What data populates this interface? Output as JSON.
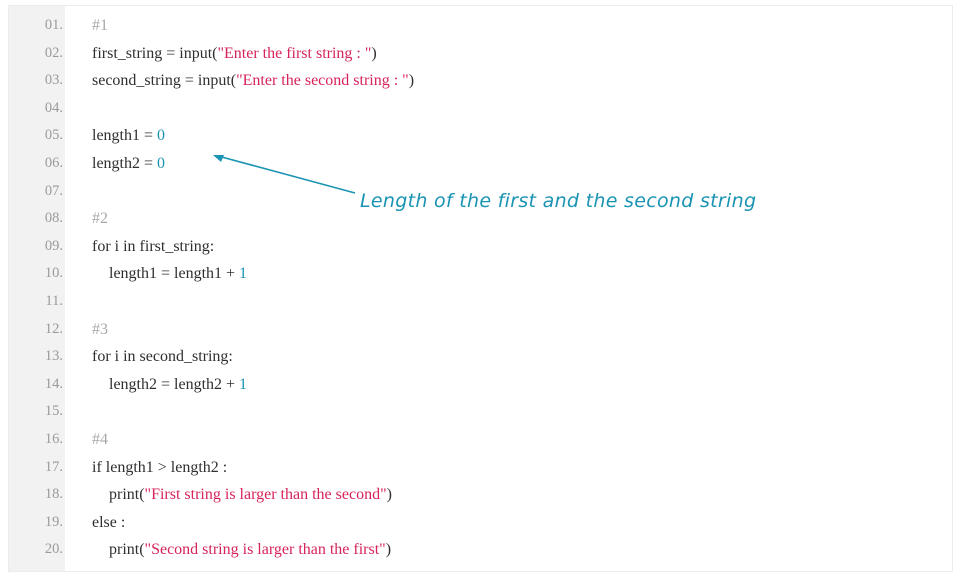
{
  "colors": {
    "string": "#d6245a",
    "number": "#1a94b3",
    "comment": "#a8a8a8",
    "annotation": "#1a94b3"
  },
  "annotation": {
    "text": "Length of the first and the second string",
    "points_to_line": "06."
  },
  "lines": [
    {
      "num": "01.",
      "parts": [
        {
          "t": "#1",
          "k": "cm"
        }
      ]
    },
    {
      "num": "02.",
      "parts": [
        {
          "t": "first_string = input(",
          "k": ""
        },
        {
          "t": "\"Enter the first string : \"",
          "k": "str"
        },
        {
          "t": ")",
          "k": ""
        }
      ]
    },
    {
      "num": "03.",
      "parts": [
        {
          "t": "second_string = input(",
          "k": ""
        },
        {
          "t": "\"Enter the second string : \"",
          "k": "str"
        },
        {
          "t": ")",
          "k": ""
        }
      ]
    },
    {
      "num": "04.",
      "parts": []
    },
    {
      "num": "05.",
      "parts": [
        {
          "t": "length1 = ",
          "k": ""
        },
        {
          "t": "0",
          "k": "num"
        }
      ]
    },
    {
      "num": "06.",
      "parts": [
        {
          "t": "length2 = ",
          "k": ""
        },
        {
          "t": "0",
          "k": "num"
        }
      ]
    },
    {
      "num": "07.",
      "parts": []
    },
    {
      "num": "08.",
      "parts": [
        {
          "t": "#2",
          "k": "cm"
        }
      ]
    },
    {
      "num": "09.",
      "parts": [
        {
          "t": "for i in first_string:",
          "k": ""
        }
      ]
    },
    {
      "num": "10.",
      "indent": true,
      "parts": [
        {
          "t": "length1 = length1 + ",
          "k": ""
        },
        {
          "t": "1",
          "k": "num"
        }
      ]
    },
    {
      "num": "11.",
      "parts": []
    },
    {
      "num": "12.",
      "parts": [
        {
          "t": "#3",
          "k": "cm"
        }
      ]
    },
    {
      "num": "13.",
      "parts": [
        {
          "t": "for i in second_string:",
          "k": ""
        }
      ]
    },
    {
      "num": "14.",
      "indent": true,
      "parts": [
        {
          "t": "length2 = length2 + ",
          "k": ""
        },
        {
          "t": "1",
          "k": "num"
        }
      ]
    },
    {
      "num": "15.",
      "parts": []
    },
    {
      "num": "16.",
      "parts": [
        {
          "t": "#4",
          "k": "cm"
        }
      ]
    },
    {
      "num": "17.",
      "parts": [
        {
          "t": "if length1 > length2 :",
          "k": ""
        }
      ]
    },
    {
      "num": "18.",
      "indent": true,
      "parts": [
        {
          "t": "print(",
          "k": ""
        },
        {
          "t": "\"First string is larger than the second\"",
          "k": "str"
        },
        {
          "t": ")",
          "k": ""
        }
      ]
    },
    {
      "num": "19.",
      "parts": [
        {
          "t": "else :",
          "k": ""
        }
      ]
    },
    {
      "num": "20.",
      "indent": true,
      "parts": [
        {
          "t": "print(",
          "k": ""
        },
        {
          "t": "\"Second string is larger than the first\"",
          "k": "str"
        },
        {
          "t": ")",
          "k": ""
        }
      ]
    }
  ]
}
